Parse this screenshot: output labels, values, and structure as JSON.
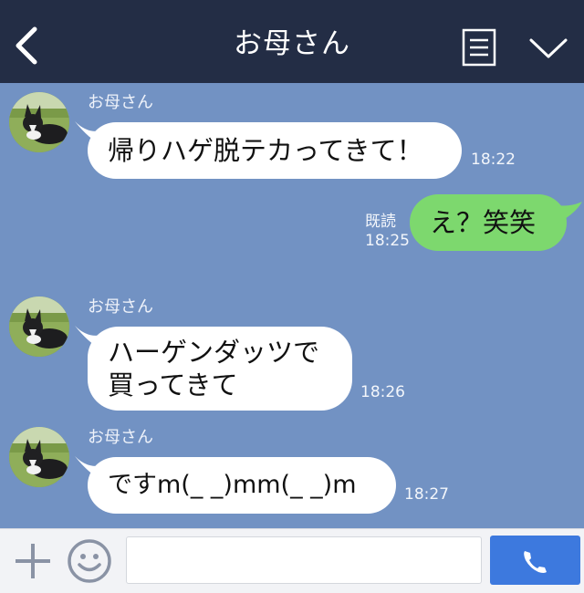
{
  "header": {
    "title": "お母さん",
    "back_icon": "chevron-left-icon",
    "menu_icon": "menu-list-icon",
    "dropdown_icon": "chevron-down-icon"
  },
  "messages": [
    {
      "from": "お母さん",
      "text": "帰りハゲ脱テカってきて！",
      "time": "18:22",
      "direction": "in"
    },
    {
      "from": "me",
      "text": "え？笑笑",
      "time": "18:25",
      "read": "既読",
      "direction": "out"
    },
    {
      "from": "お母さん",
      "text_line1": "ハーゲンダッツで",
      "text_line2": "買ってきて",
      "time": "18:26",
      "direction": "in"
    },
    {
      "from": "お母さん",
      "text": "ですm(_ _)mm(_ _)m",
      "time": "18:27",
      "direction": "in"
    }
  ],
  "input": {
    "value": "",
    "placeholder": ""
  },
  "colors": {
    "header_bg": "#232d45",
    "chat_bg": "#7292c3",
    "incoming_bubble": "#ffffff",
    "outgoing_bubble": "#7dd86e",
    "call_button": "#3d79de"
  },
  "icons": {
    "plus": "plus-icon",
    "emoji": "smiley-icon",
    "call": "phone-icon"
  }
}
